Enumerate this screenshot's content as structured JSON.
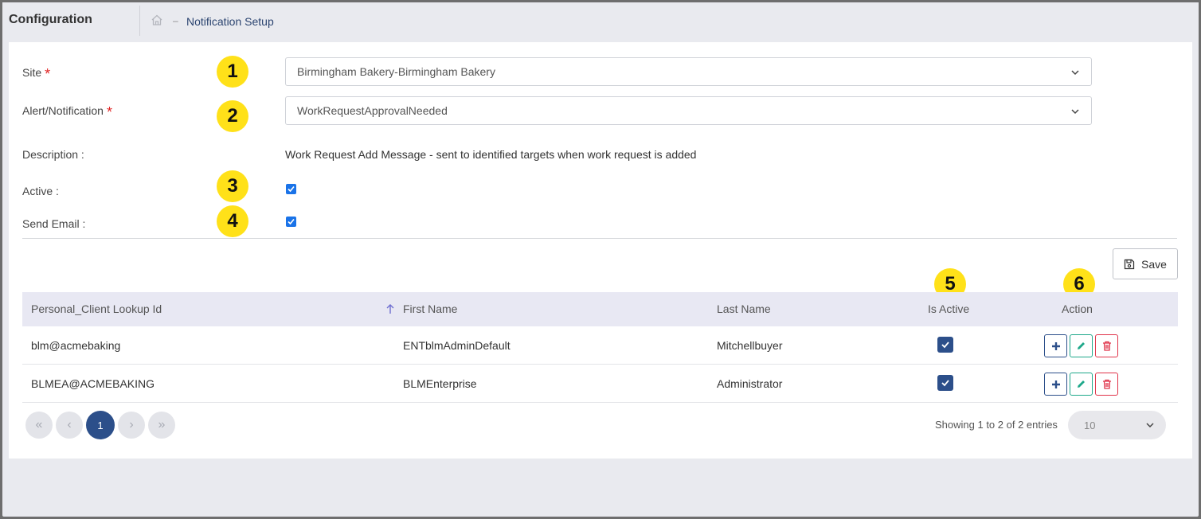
{
  "header": {
    "title": "Configuration",
    "breadcrumb_sep": "–",
    "breadcrumb_current": "Notification Setup"
  },
  "form": {
    "site_label": "Site",
    "site_value": "Birmingham Bakery-Birmingham Bakery",
    "alert_label": "Alert/Notification",
    "alert_value": "WorkRequestApprovalNeeded",
    "required_mark": "*",
    "description_label": "Description :",
    "description_value": "Work Request Add Message - sent to identified targets when work request is added",
    "active_label": "Active :",
    "active_checked": true,
    "send_email_label": "Send Email :",
    "send_email_checked": true
  },
  "badges": [
    "1",
    "2",
    "3",
    "4",
    "5",
    "6"
  ],
  "toolbar": {
    "save_label": "Save"
  },
  "table": {
    "columns": [
      "Personal_Client Lookup Id",
      "First Name",
      "Last Name",
      "Is Active",
      "Action"
    ],
    "rows": [
      {
        "lookup_id": "blm@acmebaking",
        "first_name": "ENTblmAdminDefault",
        "last_name": "Mitchellbuyer",
        "is_active": true
      },
      {
        "lookup_id": "BLMEA@ACMEBAKING",
        "first_name": "BLMEnterprise",
        "last_name": "Administrator",
        "is_active": true
      }
    ]
  },
  "pagination": {
    "current_page": "1",
    "summary": "Showing 1 to 2 of 2 entries",
    "page_size": "10",
    "first_glyph": "«",
    "prev_glyph": "‹",
    "next_glyph": "›",
    "last_glyph": "»"
  },
  "icons": [
    "home-icon",
    "chevron-down-icon",
    "checkmark-icon",
    "save-icon",
    "sort-ascending-icon",
    "plus-icon",
    "pencil-icon",
    "trash-icon"
  ],
  "colors": {
    "accent": "#2c4f8a",
    "badge": "#ffe119",
    "required": "#e02424",
    "edit": "#1ea88a",
    "delete": "#e0344a",
    "checkbox": "#1a73e8"
  }
}
